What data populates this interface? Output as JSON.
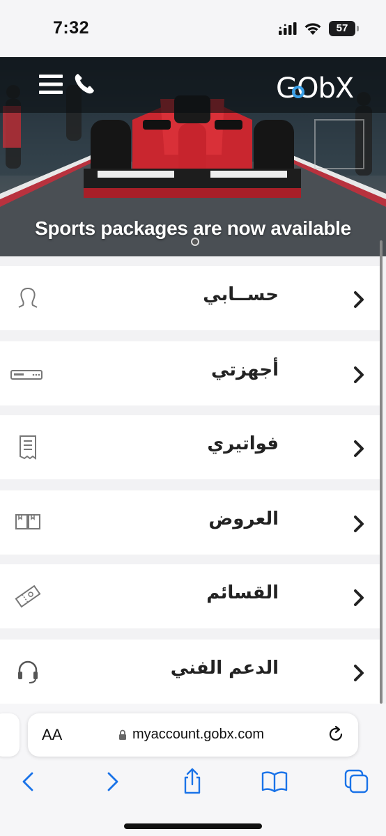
{
  "status_bar": {
    "time": "7:32",
    "battery": "57"
  },
  "header": {
    "logo_text": "GObX",
    "menu_icon": "hamburger-icon",
    "phone_icon": "phone-icon"
  },
  "hero": {
    "caption": "Sports packages are now available"
  },
  "menu": {
    "items": [
      {
        "label": "حســابي",
        "icon": "account-icon"
      },
      {
        "label": "أجهزتي",
        "icon": "device-icon"
      },
      {
        "label": "فواتيري",
        "icon": "invoice-icon"
      },
      {
        "label": "العروض",
        "icon": "offers-icon"
      },
      {
        "label": "القسائم",
        "icon": "voucher-icon"
      },
      {
        "label": "الدعم الفني",
        "icon": "support-headset-icon"
      }
    ]
  },
  "browser": {
    "aa_label": "AA",
    "url": "myaccount.gobx.com",
    "accent": "#1a73e8"
  }
}
